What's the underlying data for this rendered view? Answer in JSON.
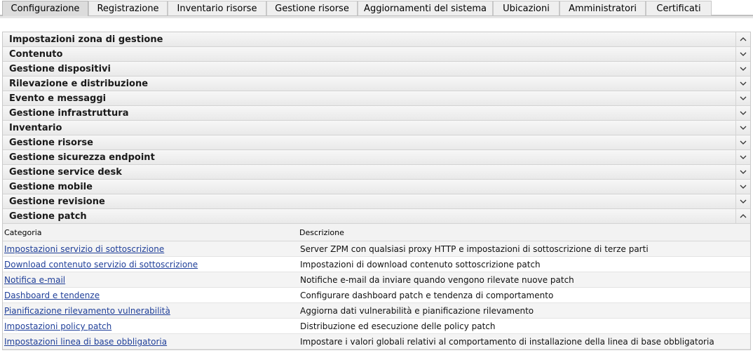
{
  "tabs": [
    {
      "label": "Configurazione",
      "active": true
    },
    {
      "label": "Registrazione"
    },
    {
      "label": "Inventario risorse"
    },
    {
      "label": "Gestione risorse"
    },
    {
      "label": "Aggiornamenti del sistema"
    },
    {
      "label": "Ubicazioni"
    },
    {
      "label": "Amministratori"
    },
    {
      "label": "Certificati"
    }
  ],
  "sections": [
    {
      "label": "Impostazioni zona di gestione",
      "state": "expanded"
    },
    {
      "label": "Contenuto",
      "state": "collapsed"
    },
    {
      "label": "Gestione dispositivi",
      "state": "collapsed"
    },
    {
      "label": "Rilevazione e distribuzione",
      "state": "collapsed"
    },
    {
      "label": "Evento e messaggi",
      "state": "collapsed"
    },
    {
      "label": "Gestione infrastruttura",
      "state": "collapsed"
    },
    {
      "label": "Inventario",
      "state": "collapsed"
    },
    {
      "label": "Gestione risorse",
      "state": "collapsed"
    },
    {
      "label": "Gestione sicurezza endpoint",
      "state": "collapsed"
    },
    {
      "label": "Gestione service desk",
      "state": "collapsed"
    },
    {
      "label": "Gestione mobile",
      "state": "collapsed"
    },
    {
      "label": "Gestione revisione",
      "state": "collapsed"
    },
    {
      "label": "Gestione patch",
      "state": "expanded"
    }
  ],
  "patch_table": {
    "col_category": "Categoria",
    "col_description": "Descrizione",
    "rows": [
      {
        "category": "Impostazioni servizio di sottoscrizione",
        "description": "Server ZPM con qualsiasi proxy HTTP e impostazioni di sottoscrizione di terze parti"
      },
      {
        "category": "Download contenuto servizio di sottoscrizione",
        "description": "Impostazioni di download contenuto sottoscrizione patch"
      },
      {
        "category": "Notifica e-mail",
        "description": "Notifiche e-mail da inviare quando vengono rilevate nuove patch"
      },
      {
        "category": "Dashboard e tendenze",
        "description": "Configurare dashboard patch e tendenza di comportamento"
      },
      {
        "category": "Pianificazione rilevamento vulnerabilità",
        "description": "Aggiorna dati vulnerabilità e pianificazione rilevamento"
      },
      {
        "category": "Impostazioni policy patch",
        "description": "Distribuzione ed esecuzione delle policy patch"
      },
      {
        "category": "Impostazioni linea di base obbligatoria",
        "description": "Impostare i valori globali relativi al comportamento di installazione della linea di base obbligatoria"
      }
    ]
  },
  "icons": {
    "expanded": "chevron-up-icon",
    "collapsed": "chevron-down-icon"
  }
}
